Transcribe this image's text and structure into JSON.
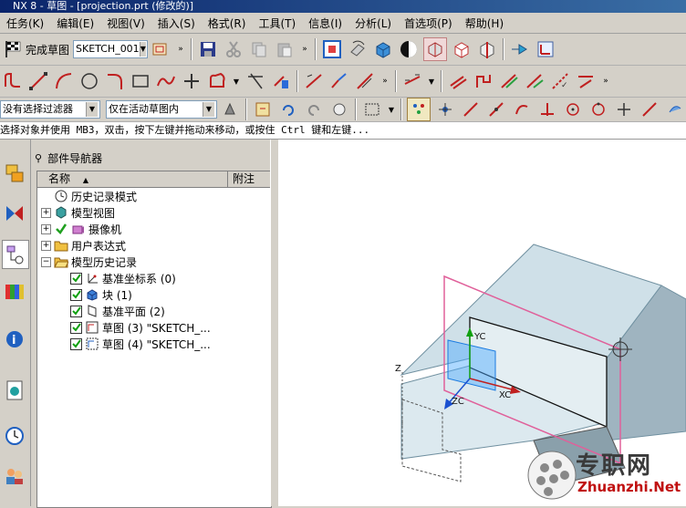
{
  "window": {
    "title": "NX 8 - 草图 - [projection.prt (修改的)]"
  },
  "menu": [
    "任务(K)",
    "编辑(E)",
    "视图(V)",
    "插入(S)",
    "格式(R)",
    "工具(T)",
    "信息(I)",
    "分析(L)",
    "首选项(P)",
    "帮助(H)"
  ],
  "toolbar": {
    "finish_sketch_label": "完成草图",
    "sketch_name": "SKETCH_001",
    "filter_label": "没有选择过滤器",
    "scope_label": "仅在活动草图内"
  },
  "status": {
    "prompt": "选择对象并使用 MB3，双击，按下左键并拖动来移动，或按住 Ctrl 键和左键..."
  },
  "navigator": {
    "title": "部件导航器",
    "col_name": "名称",
    "col_note": "附注",
    "items": [
      {
        "label": "历史记录模式"
      },
      {
        "label": "模型视图"
      },
      {
        "label": "摄像机"
      },
      {
        "label": "用户表达式"
      },
      {
        "label": "模型历史记录"
      },
      {
        "label": "基准坐标系 (0)"
      },
      {
        "label": "块 (1)"
      },
      {
        "label": "基准平面 (2)"
      },
      {
        "label": "草图 (3) \"SKETCH_..."
      },
      {
        "label": "草图 (4) \"SKETCH_..."
      }
    ]
  },
  "viewport": {
    "axis_yc": "YC",
    "axis_xc": "XC",
    "axis_zc": "ZC",
    "axis_z": "Z",
    "colors": {
      "box_face": "#d8e6ec",
      "box_side": "#aabec8",
      "plane": "#e0609a",
      "sketch_plane": "#4aa8ff"
    }
  },
  "watermark": {
    "text": "专职网",
    "url": "Zhuanzhi.Net"
  }
}
